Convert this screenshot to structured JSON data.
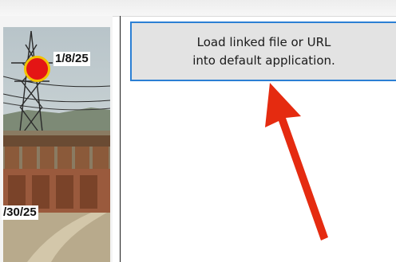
{
  "tooltip": {
    "line1": "Load linked file or URL",
    "line2": "into default application."
  },
  "photo": {
    "date_label_1": "1/8/25",
    "date_label_2": "/30/25"
  },
  "colors": {
    "tooltip_border": "#2b7fd4",
    "tooltip_background": "#e3e3e3",
    "marker_fill": "#e41515",
    "marker_ring": "#f2c200",
    "arrow": "#e52b10"
  }
}
